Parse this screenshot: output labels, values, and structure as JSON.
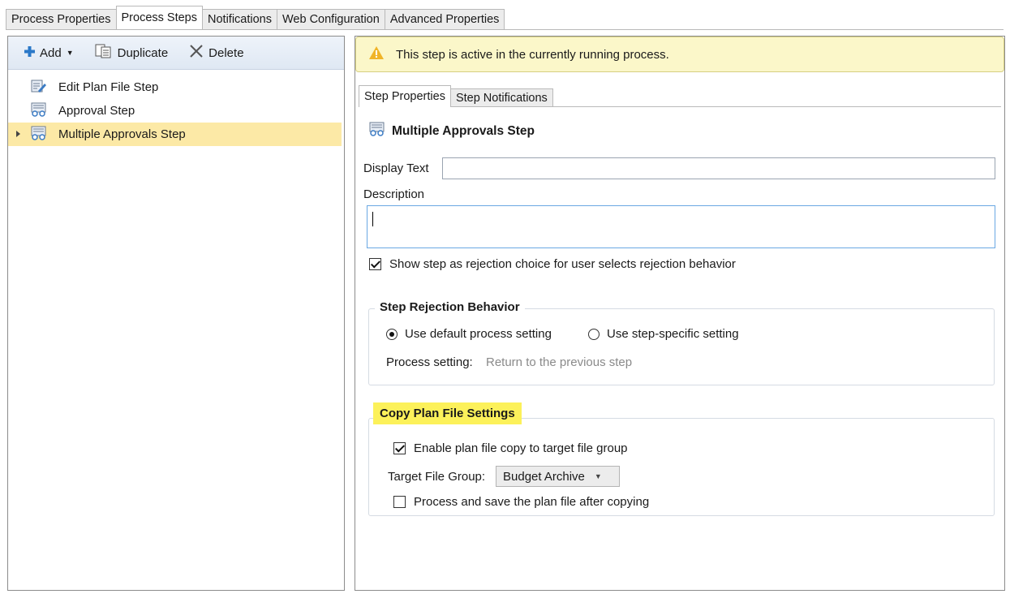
{
  "top_tabs": [
    "Process Properties",
    "Process Steps",
    "Notifications",
    "Web Configuration",
    "Advanced Properties"
  ],
  "toolbar": {
    "add": "Add",
    "duplicate": "Duplicate",
    "delete": "Delete"
  },
  "tree": [
    {
      "label": "Edit Plan File Step",
      "icon": "edit-step-icon"
    },
    {
      "label": "Approval Step",
      "icon": "approval-step-icon"
    },
    {
      "label": "Multiple Approvals Step",
      "icon": "approval-step-icon",
      "selected": true
    }
  ],
  "warning": "This step is active in the currently running process.",
  "inner_tabs": [
    "Step Properties",
    "Step Notifications"
  ],
  "step": {
    "title": "Multiple Approvals Step",
    "display_text_label": "Display Text",
    "display_text_value": "",
    "description_label": "Description",
    "description_value": "",
    "show_rejection_choice": "Show step as rejection choice for user selects rejection behavior",
    "show_rejection_checked": true
  },
  "rejection": {
    "title": "Step Rejection Behavior",
    "option_default": "Use default process setting",
    "option_specific": "Use step-specific setting",
    "selected": "default",
    "process_setting_label": "Process setting:",
    "process_setting_value": "Return to the previous step"
  },
  "copy": {
    "title": "Copy Plan File Settings",
    "enable_label": "Enable plan file copy to target file group",
    "enable_checked": true,
    "target_label": "Target File Group:",
    "target_value": "Budget Archive",
    "process_label": "Process and save the plan file after copying",
    "process_checked": false
  },
  "colors": {
    "highlight": "#fcf15a",
    "selected_row": "#fce9a6",
    "warning_bg": "#fbf7c9"
  }
}
